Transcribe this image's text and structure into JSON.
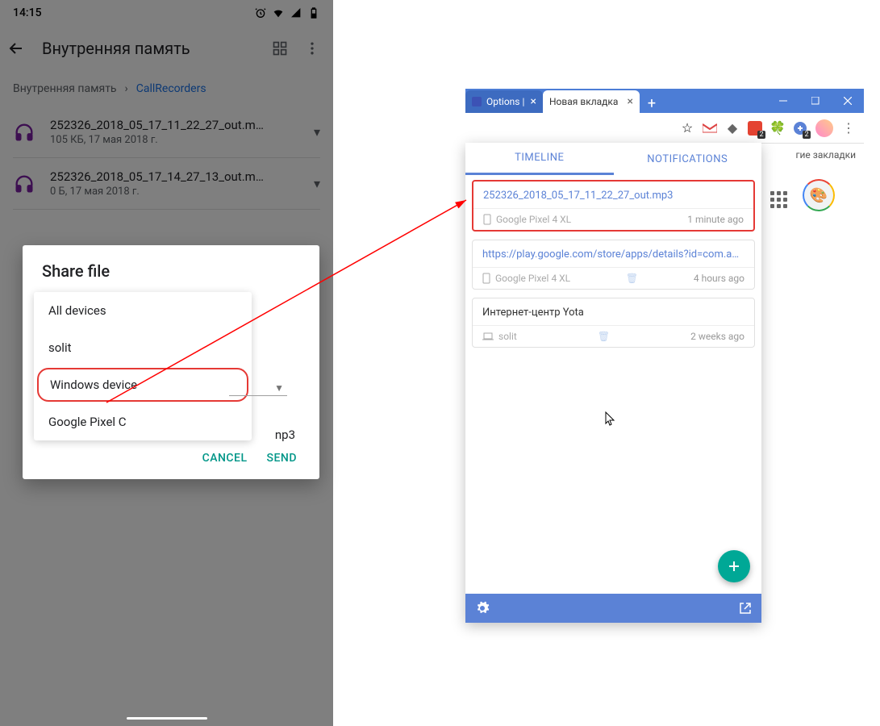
{
  "phone": {
    "time": "14:15",
    "appbar_title": "Внутренняя память",
    "breadcrumb_root": "Внутренняя память",
    "breadcrumb_current": "CallRecorders",
    "files": [
      {
        "name": "252326_2018_05_17_11_22_27_out.m…",
        "meta": "105 КБ, 17 мая 2018 г."
      },
      {
        "name": "252326_2018_05_17_14_27_13_out.m…",
        "meta": "0 Б, 17 мая 2018 г."
      }
    ],
    "dialog": {
      "title": "Share file",
      "devices": [
        "All devices",
        "solit",
        "Windows device",
        "Google Pixel C"
      ],
      "highlighted_index": 2,
      "extension_visible": "np3",
      "cancel": "CANCEL",
      "send": "SEND"
    }
  },
  "chrome": {
    "tabs": [
      {
        "label": "Options | Pi",
        "active": false
      },
      {
        "label": "Новая вкладка",
        "active": true
      }
    ],
    "bookmarks_overflow": "гие закладки",
    "badge_todoist": "2",
    "badge_ext": "2"
  },
  "popup": {
    "tab_timeline": "TIMELINE",
    "tab_notifications": "NOTIFICATIONS",
    "items": [
      {
        "title": "252326_2018_05_17_11_22_27_out.mp3",
        "device": "Google Pixel 4 XL",
        "device_type": "phone",
        "time": "1 minute ago",
        "highlighted": true
      },
      {
        "title": "https://play.google.com/store/apps/details?id=com.apple.qrc…",
        "device": "Google Pixel 4 XL",
        "device_type": "phone",
        "time": "4 hours ago",
        "highlighted": false
      },
      {
        "title": "Интернет-центр Yota",
        "device": "solit",
        "device_type": "laptop",
        "time": "2 weeks ago",
        "highlighted": false,
        "dark": true
      }
    ]
  }
}
